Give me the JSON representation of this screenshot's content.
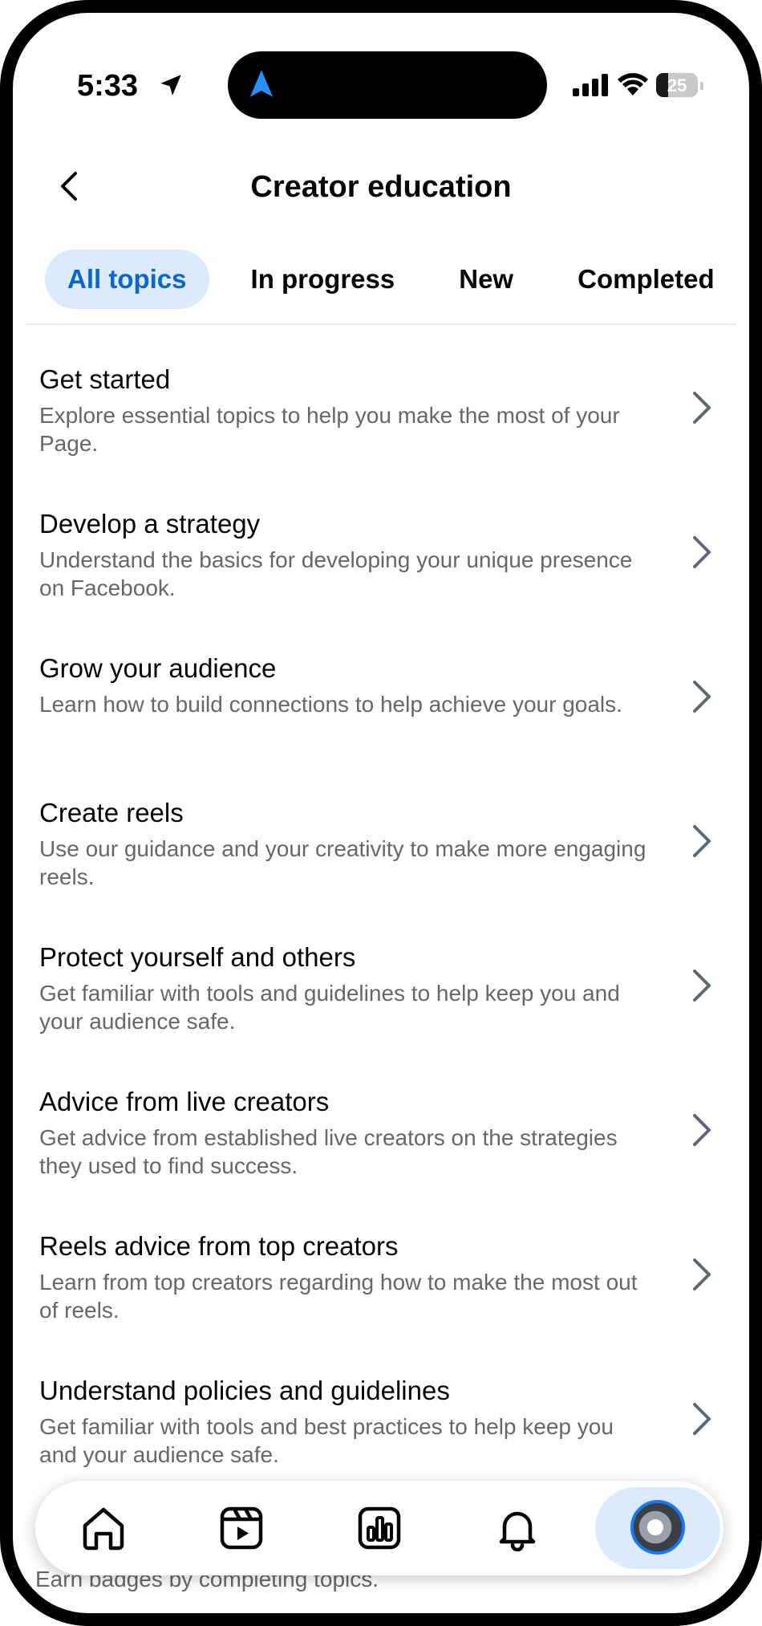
{
  "status_bar": {
    "time": "5:33",
    "battery": "25"
  },
  "header": {
    "title": "Creator education"
  },
  "tabs": [
    {
      "label": "All topics",
      "active": true
    },
    {
      "label": "In progress",
      "active": false
    },
    {
      "label": "New",
      "active": false
    },
    {
      "label": "Completed",
      "active": false
    }
  ],
  "topics": [
    {
      "title": "Get started",
      "description": "Explore essential topics to help you make the most of your Page."
    },
    {
      "title": "Develop a strategy",
      "description": "Understand the basics for developing your unique presence on Facebook."
    },
    {
      "title": "Grow your audience",
      "description": "Learn how to build connections to help achieve your goals."
    },
    {
      "title": "Create reels",
      "description": "Use our guidance and your creativity to make more engaging reels."
    },
    {
      "title": "Protect yourself and others",
      "description": "Get familiar with tools and guidelines to help keep you and your audience safe."
    },
    {
      "title": "Advice from live creators",
      "description": "Get advice from established live creators on the strategies they used to find success."
    },
    {
      "title": "Reels advice from top creators",
      "description": "Learn from top creators regarding how to make the most out of reels."
    },
    {
      "title": "Understand policies and guidelines",
      "description": "Get familiar with tools and best practices to help keep you and your audience safe."
    }
  ],
  "partial_item": {
    "description": "Earn badges by completing topics."
  },
  "bottom_nav": {
    "items": [
      "home-icon",
      "reels-icon",
      "insights-icon",
      "notifications-icon",
      "profile-avatar"
    ],
    "active": "profile-avatar"
  },
  "colors": {
    "accent": "#0a66c8",
    "tab_active_bg": "#dbeafc",
    "secondary_text": "#65676b"
  }
}
